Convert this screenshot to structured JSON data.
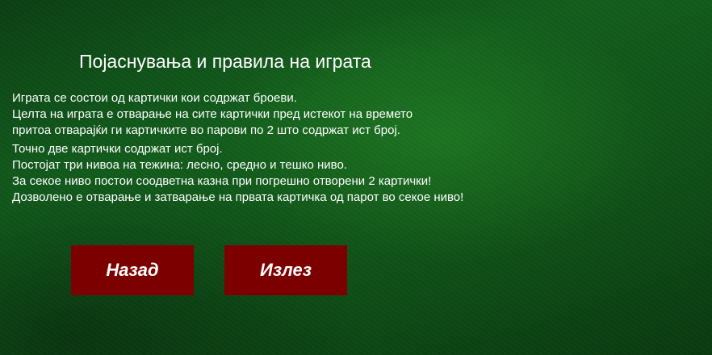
{
  "title": "Појаснувања и правила на играта",
  "rules": [
    "Играта се состои од картички кои содржат броеви.",
    "Целта на играта е отварање на сите картички пред истекот на времето",
    "притоа отварајќи ги картичките во парови по 2 што содржат ист број.",
    "Точно две картички содржат ист број.",
    "Постојат три нивоа на тежина: лесно, средно и тешко ниво.",
    "За секое ниво постои соодветна казна при погрешно отворени 2 картички!",
    "Дозволено е отварање и затварање на првата картичка од парот во секое ниво!"
  ],
  "buttons": {
    "back": "Назад",
    "exit": "Излез"
  },
  "colors": {
    "button_bg": "#7d0000",
    "background": "#125e1d",
    "text": "#ffffff"
  }
}
